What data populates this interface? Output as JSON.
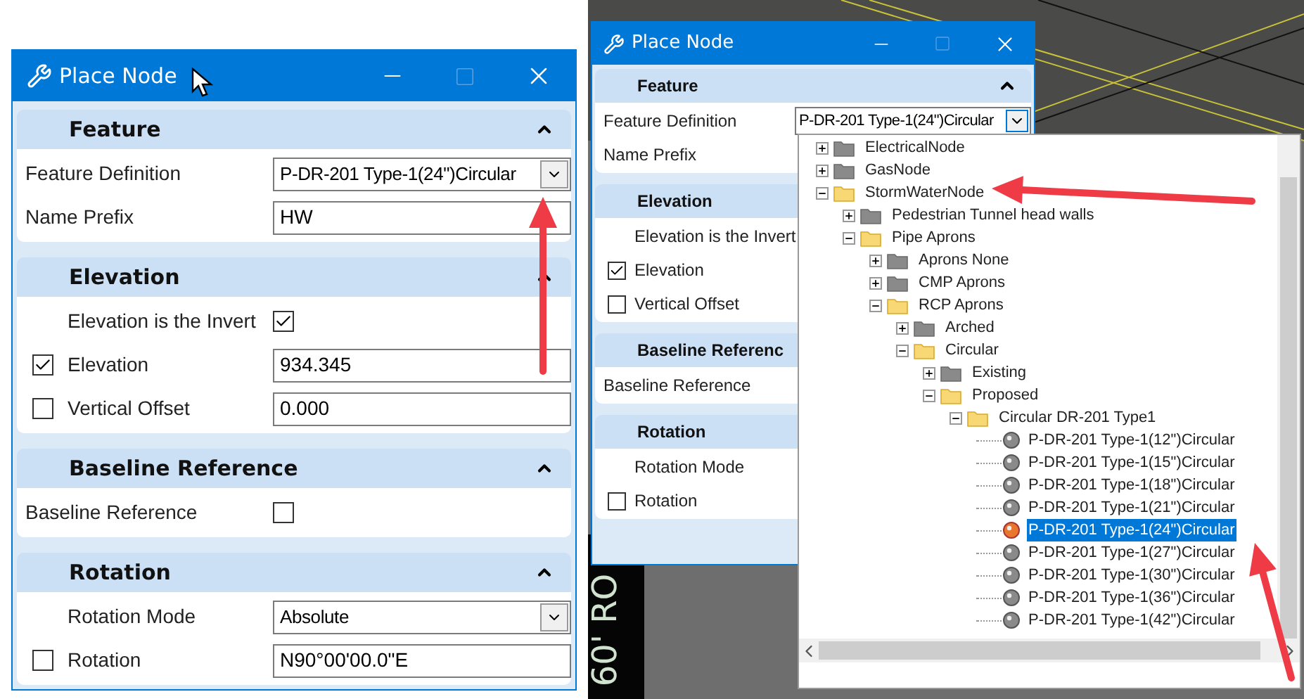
{
  "left_window": {
    "title": "Place Node",
    "sections": [
      {
        "title": "Feature",
        "expanded": true,
        "rows": [
          {
            "kind": "combo",
            "label": "Feature Definition",
            "value": "P-DR-201 Type-1(24\")Circular"
          },
          {
            "kind": "field",
            "label": "Name Prefix",
            "value": "HW"
          }
        ]
      },
      {
        "title": "Elevation",
        "expanded": true,
        "rows": [
          {
            "kind": "toggle",
            "label": "Elevation is the Invert",
            "checked": true
          },
          {
            "kind": "check_field",
            "label": "Elevation",
            "checked": true,
            "value": "934.345"
          },
          {
            "kind": "check_field",
            "label": "Vertical Offset",
            "checked": false,
            "value": "0.000"
          }
        ]
      },
      {
        "title": "Baseline Reference",
        "expanded": true,
        "rows": [
          {
            "kind": "toggle",
            "label": "Baseline Reference",
            "checked": false
          }
        ]
      },
      {
        "title": "Rotation",
        "expanded": true,
        "rows": [
          {
            "kind": "combo",
            "label": "Rotation Mode",
            "value": "Absolute"
          },
          {
            "kind": "check_field",
            "label": "Rotation",
            "checked": false,
            "value": "N90°00'00.0\"E"
          }
        ]
      }
    ]
  },
  "right_window": {
    "title": "Place Node",
    "sections": [
      {
        "title": "Feature",
        "expanded": true,
        "rows": [
          {
            "kind": "combo",
            "label": "Feature Definition",
            "value": "P-DR-201 Type-1(24\")Circular"
          },
          {
            "kind": "field",
            "label": "Name Prefix"
          }
        ]
      },
      {
        "title": "Elevation",
        "rows": [
          {
            "kind": "toggle",
            "label": "Elevation is the Invert"
          },
          {
            "kind": "check_field",
            "label": "Elevation",
            "checked": true
          },
          {
            "kind": "check_field",
            "label": "Vertical Offset",
            "checked": false
          }
        ]
      },
      {
        "title": "Baseline Referenc",
        "rows": [
          {
            "kind": "toggle",
            "label": "Baseline Reference"
          }
        ]
      },
      {
        "title": "Rotation",
        "rows": [
          {
            "kind": "combo",
            "label": "Rotation Mode"
          },
          {
            "kind": "check_field",
            "label": "Rotation",
            "checked": false
          }
        ]
      }
    ]
  },
  "cad_text": "60' RO",
  "tree": [
    {
      "label": "ElectricalNode",
      "expanded": false
    },
    {
      "label": "GasNode",
      "expanded": false
    },
    {
      "label": "StormWaterNode",
      "expanded": true,
      "children": [
        {
          "label": "Pedestrian Tunnel head walls",
          "expanded": false
        },
        {
          "label": "Pipe Aprons",
          "expanded": true,
          "children": [
            {
              "label": "Aprons None",
              "expanded": false
            },
            {
              "label": "CMP Aprons",
              "expanded": false
            },
            {
              "label": "RCP Aprons",
              "expanded": true,
              "children": [
                {
                  "label": "Arched",
                  "expanded": false
                },
                {
                  "label": "Circular",
                  "expanded": true,
                  "children": [
                    {
                      "label": "Existing",
                      "expanded": false
                    },
                    {
                      "label": "Proposed",
                      "expanded": true,
                      "children": [
                        {
                          "label": "Circular DR-201 Type1",
                          "expanded": true,
                          "children": [
                            {
                              "kind": "item",
                              "label": "P-DR-201 Type-1(12\")Circular",
                              "selected": false
                            },
                            {
                              "kind": "item",
                              "label": "P-DR-201 Type-1(15\")Circular",
                              "selected": false
                            },
                            {
                              "kind": "item",
                              "label": "P-DR-201 Type-1(18\")Circular",
                              "selected": false
                            },
                            {
                              "kind": "item",
                              "label": "P-DR-201 Type-1(21\")Circular",
                              "selected": false
                            },
                            {
                              "kind": "item",
                              "label": "P-DR-201 Type-1(24\")Circular",
                              "selected": true
                            },
                            {
                              "kind": "item",
                              "label": "P-DR-201 Type-1(27\")Circular",
                              "selected": false
                            },
                            {
                              "kind": "item",
                              "label": "P-DR-201 Type-1(30\")Circular",
                              "selected": false
                            },
                            {
                              "kind": "item",
                              "label": "P-DR-201 Type-1(36\")Circular",
                              "selected": false
                            },
                            {
                              "kind": "item",
                              "label": "P-DR-201 Type-1(42\")Circular",
                              "selected": false
                            }
                          ]
                        }
                      ]
                    }
                  ]
                }
              ]
            }
          ]
        }
      ]
    }
  ]
}
